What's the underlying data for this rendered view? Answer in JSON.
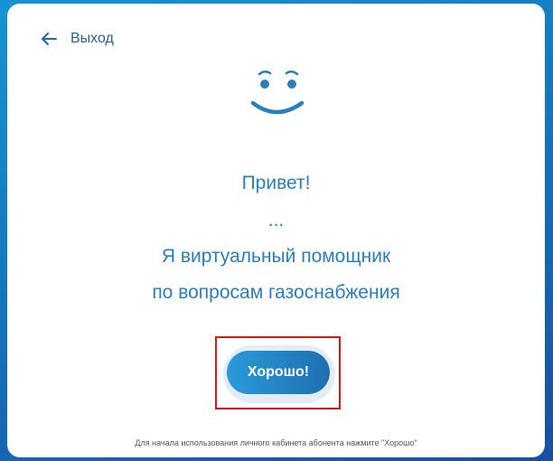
{
  "header": {
    "back_label": "Выход",
    "back_icon": "arrow-left-icon"
  },
  "mascot": {
    "icon": "smiley-face-icon"
  },
  "greeting": {
    "line1": "Привет!",
    "line2": "...",
    "line3": "Я виртуальный помощник",
    "line4": "по вопросам газоснабжения"
  },
  "actions": {
    "ok_label": "Хорошо!"
  },
  "footer": {
    "hint": "Для начала использования личного кабинета абонента нажмите \"Хорошо\""
  },
  "colors": {
    "accent": "#1f6fb0",
    "highlight_border": "#e0141b",
    "text": "#2a7fb8"
  }
}
